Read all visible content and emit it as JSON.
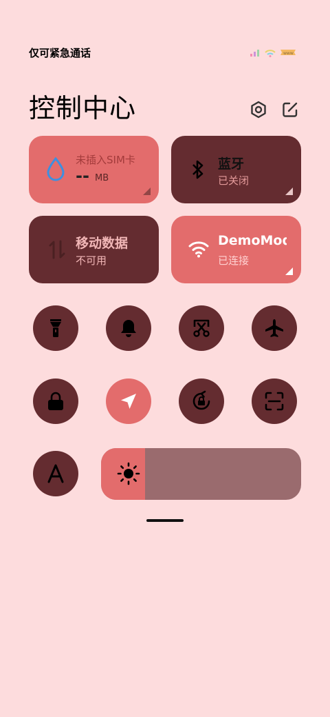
{
  "status_bar": {
    "carrier_text": "仅可紧急通话"
  },
  "header": {
    "title": "控制中心",
    "settings_icon": "gear-hexagon-icon",
    "edit_icon": "edit-icon"
  },
  "tiles": {
    "data_usage": {
      "label": "未插入SIM卡",
      "value": "--",
      "unit": "MB",
      "icon": "water-drop-icon"
    },
    "bluetooth": {
      "label": "蓝牙",
      "status": "已关闭",
      "icon": "bluetooth-icon"
    },
    "mobile_data": {
      "label": "移动数据",
      "status": "不可用",
      "icon": "data-arrows-icon"
    },
    "wifi": {
      "label": "DemoMod",
      "status": "已连接",
      "icon": "wifi-icon"
    }
  },
  "toggles": [
    {
      "name": "flashlight",
      "icon": "flashlight-icon",
      "active": false
    },
    {
      "name": "notifications",
      "icon": "bell-icon",
      "active": false
    },
    {
      "name": "screenshot",
      "icon": "scissors-icon",
      "active": false
    },
    {
      "name": "airplane-mode",
      "icon": "airplane-icon",
      "active": false
    },
    {
      "name": "lock-screen",
      "icon": "lock-icon",
      "active": false
    },
    {
      "name": "location",
      "icon": "location-arrow-icon",
      "active": true
    },
    {
      "name": "rotation-lock",
      "icon": "rotation-lock-icon",
      "active": false
    },
    {
      "name": "scanner",
      "icon": "scan-icon",
      "active": false
    },
    {
      "name": "font-size",
      "icon": "font-a-icon",
      "active": false
    }
  ],
  "brightness": {
    "level": 0.22,
    "icon": "sun-icon"
  },
  "colors": {
    "background": "#fddcdd",
    "active": "#e36c6c",
    "inactive": "#642c30",
    "slider_track": "#9a6b6e"
  }
}
